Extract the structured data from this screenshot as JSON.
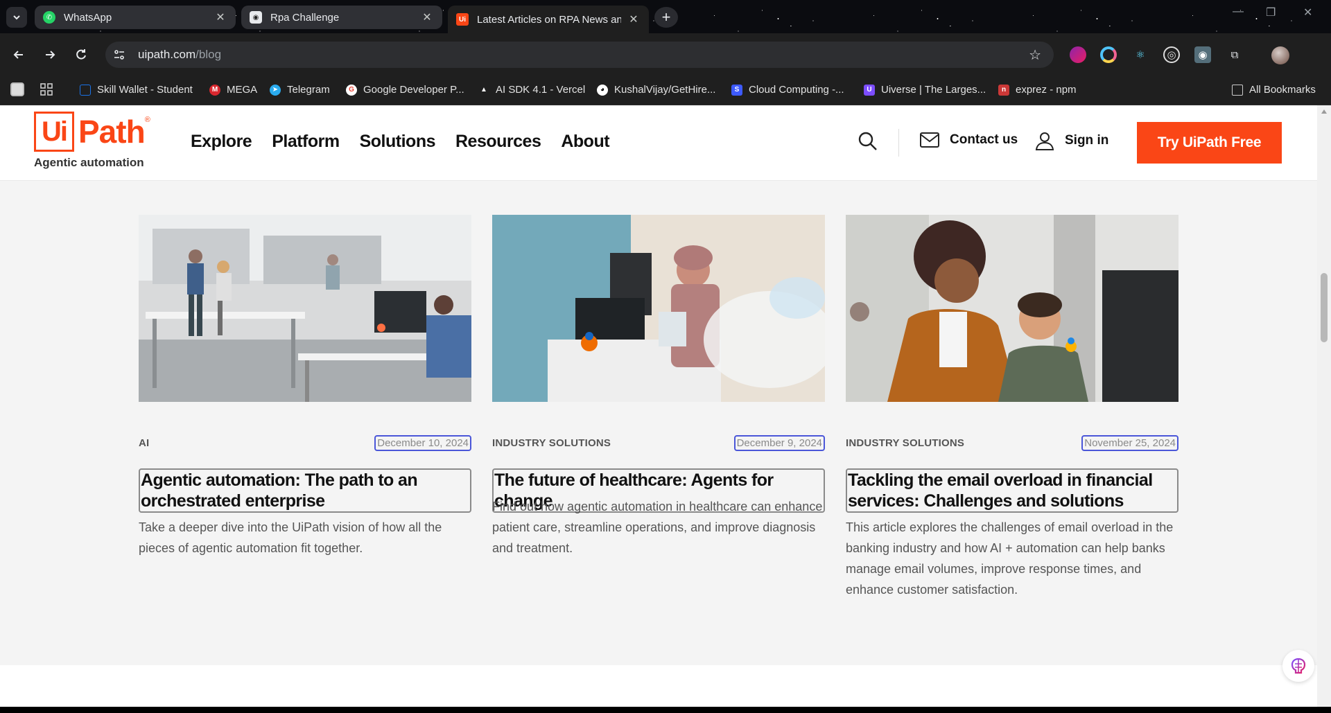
{
  "browser": {
    "tabs": [
      {
        "title": "WhatsApp",
        "icon": "whatsapp-icon",
        "color": "#25d366",
        "active": false
      },
      {
        "title": "Rpa Challenge",
        "icon": "robot-icon",
        "color": "#ffffff",
        "active": false
      },
      {
        "title": "Latest Articles on RPA News an",
        "icon": "uipath-icon",
        "color": "#fa4616",
        "active": true
      }
    ],
    "new_tab_label": "+",
    "url_host": "uipath.com",
    "url_path": "/blog",
    "bookmarks": [
      {
        "label": "Skill Wallet - Student",
        "icon": "skill-wallet-icon",
        "color": "#1a73e8"
      },
      {
        "label": "MEGA",
        "icon": "mega-icon",
        "color": "#d9272e"
      },
      {
        "label": "Telegram",
        "icon": "telegram-icon",
        "color": "#2aabee"
      },
      {
        "label": "Google Developer P...",
        "icon": "google-icon",
        "color": "#ea4335"
      },
      {
        "label": "AI SDK 4.1 - Vercel",
        "icon": "vercel-icon",
        "color": "#ffffff"
      },
      {
        "label": "KushalVijay/GetHire...",
        "icon": "github-icon",
        "color": "#ffffff"
      },
      {
        "label": "Cloud Computing -...",
        "icon": "cloud-icon",
        "color": "#3d5afe"
      },
      {
        "label": "Uiverse | The Larges...",
        "icon": "uiverse-icon",
        "color": "#7c4dff"
      },
      {
        "label": "exprez - npm",
        "icon": "npm-icon",
        "color": "#cb3837"
      }
    ],
    "all_bookmarks_label": "All Bookmarks"
  },
  "site": {
    "logo_ui": "Ui",
    "logo_path": "Path",
    "logo_reg": "®",
    "tagline": "Agentic automation",
    "nav": [
      "Explore",
      "Platform",
      "Solutions",
      "Resources",
      "About"
    ],
    "contact_label": "Contact us",
    "signin_label": "Sign in",
    "cta_label": "Try UiPath Free",
    "accent": "#fa4616"
  },
  "articles": [
    {
      "category": "AI",
      "date": "December 10, 2024",
      "title": "Agentic automation: The path to an orchestrated enterprise",
      "description": "Take a deeper dive into the UiPath vision of how all the pieces of agentic automation fit together."
    },
    {
      "category": "INDUSTRY SOLUTIONS",
      "date": "December 9, 2024",
      "title": "The future of healthcare: Agents for change",
      "description": "Find out how agentic automation in healthcare can enhance patient care, streamline operations, and improve diagnosis and treatment."
    },
    {
      "category": "INDUSTRY SOLUTIONS",
      "date": "November 25, 2024",
      "title": "Tackling the email overload in financial services: Challenges and solutions",
      "description": "This article explores the challenges of email overload in the banking industry and how AI + automation can help banks manage email volumes, improve response times, and enhance customer satisfaction."
    }
  ]
}
